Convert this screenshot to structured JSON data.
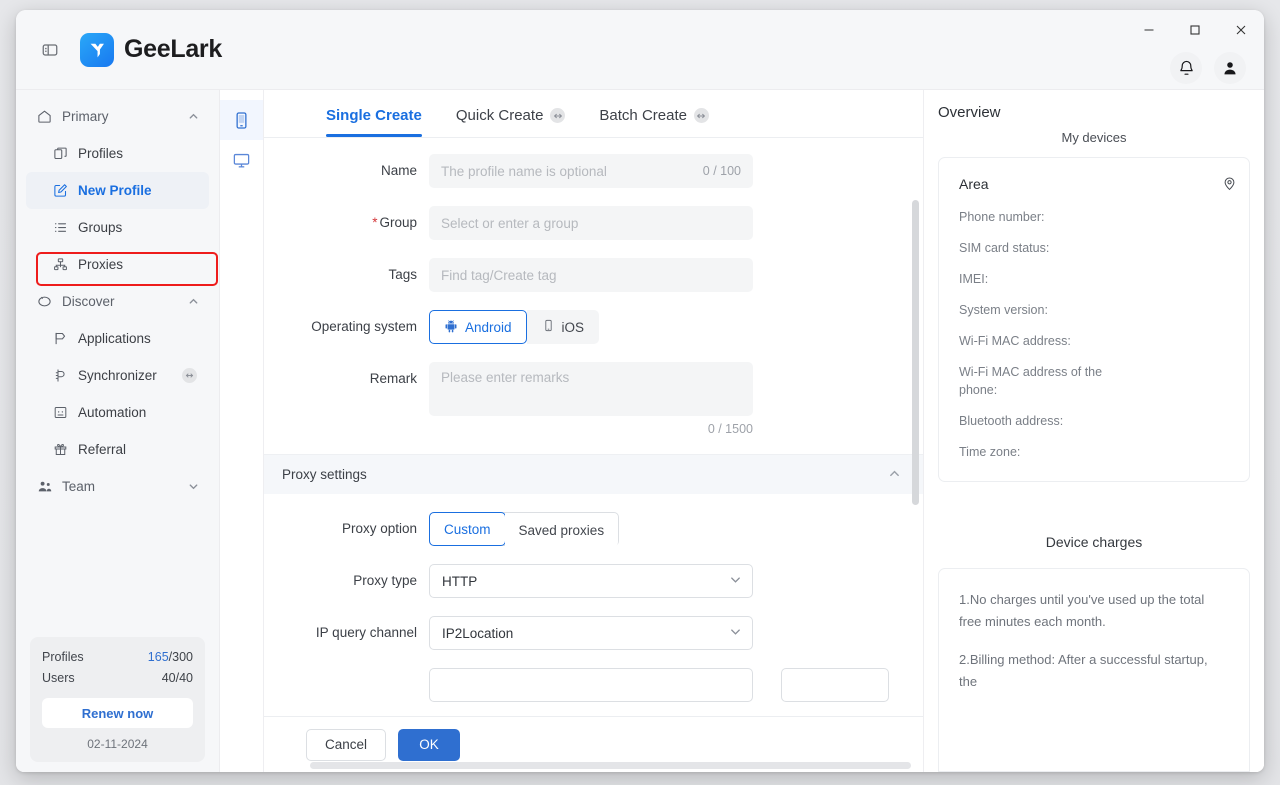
{
  "window": {
    "controls": {
      "minimize": "minimize-icon",
      "maximize": "maximize-icon",
      "close": "close-icon"
    }
  },
  "header": {
    "brand": "GeeLark",
    "panel_toggle_icon": "panel-toggle-icon",
    "bell_icon": "bell-icon",
    "avatar_icon": "user-avatar-icon"
  },
  "sidebar": {
    "groups": [
      {
        "label": "Primary",
        "icon": "home-icon",
        "caret": "chevron-up-icon",
        "items": [
          {
            "label": "Profiles",
            "icon": "profiles-icon",
            "active": false
          },
          {
            "label": "New Profile",
            "icon": "edit-square-icon",
            "active": true
          },
          {
            "label": "Groups",
            "icon": "list-icon",
            "active": false
          },
          {
            "label": "Proxies",
            "icon": "network-icon",
            "active": false
          }
        ]
      },
      {
        "label": "Discover",
        "icon": "compass-icon",
        "caret": "chevron-up-icon",
        "items": [
          {
            "label": "Applications",
            "icon": "apps-icon",
            "active": false
          },
          {
            "label": "Synchronizer",
            "icon": "sync-icon",
            "active": false,
            "badge": "collapse-badge-icon"
          },
          {
            "label": "Automation",
            "icon": "automation-icon",
            "active": false
          },
          {
            "label": "Referral",
            "icon": "gift-icon",
            "active": false
          }
        ]
      },
      {
        "label": "Team",
        "icon": "team-icon",
        "caret": "chevron-down-icon",
        "items": []
      }
    ],
    "quota": {
      "profiles_label": "Profiles",
      "profiles_used": "165",
      "profiles_total": "/300",
      "users_label": "Users",
      "users_value": "40/40",
      "renew_label": "Renew now",
      "date": "02-11-2024"
    }
  },
  "rail": [
    {
      "name": "phone-icon",
      "active": true
    },
    {
      "name": "desktop-icon",
      "active": false
    }
  ],
  "main": {
    "tabs": [
      {
        "label": "Single Create",
        "active": true,
        "badge": null
      },
      {
        "label": "Quick Create",
        "active": false,
        "badge": "collapse-badge-icon"
      },
      {
        "label": "Batch Create",
        "active": false,
        "badge": "collapse-badge-icon"
      }
    ],
    "form": {
      "name": {
        "label": "Name",
        "placeholder": "The profile name is optional",
        "value": "",
        "counter": "0 / 100"
      },
      "group": {
        "label": "Group",
        "required": true,
        "placeholder": "Select or enter a group",
        "value": ""
      },
      "tags": {
        "label": "Tags",
        "placeholder": "Find tag/Create tag",
        "value": ""
      },
      "os": {
        "label": "Operating system",
        "options": [
          "Android",
          "iOS"
        ],
        "selected": "Android"
      },
      "remark": {
        "label": "Remark",
        "placeholder": "Please enter remarks",
        "value": "",
        "counter": "0 / 1500"
      }
    },
    "proxy_section": {
      "title": "Proxy settings",
      "collapse_icon": "chevron-up-icon",
      "proxy_option": {
        "label": "Proxy option",
        "options": [
          "Custom",
          "Saved proxies"
        ],
        "selected": "Custom"
      },
      "proxy_type": {
        "label": "Proxy type",
        "value": "HTTP"
      },
      "ip_query_channel": {
        "label": "IP query channel",
        "value": "IP2Location"
      }
    },
    "footer": {
      "cancel": "Cancel",
      "ok": "OK"
    }
  },
  "overview": {
    "title": "Overview",
    "subtitle": "My devices",
    "area_label": "Area",
    "pin_icon": "location-pin-icon",
    "fields": [
      "Phone number:",
      "SIM card status:",
      "IMEI:",
      "System version:",
      "Wi-Fi MAC address:",
      "Wi-Fi MAC address of the phone:",
      "Bluetooth address:",
      "Time zone:"
    ],
    "charges_title": "Device charges",
    "charges": [
      "1.No charges until you've used up the total free minutes each month.",
      "2.Billing method: After a successful startup, the"
    ]
  },
  "colors": {
    "accent": "#1a6fe0",
    "primary_button": "#2f6fd0",
    "highlight_box": "#ee1c1c",
    "required_star": "#d4383b"
  }
}
